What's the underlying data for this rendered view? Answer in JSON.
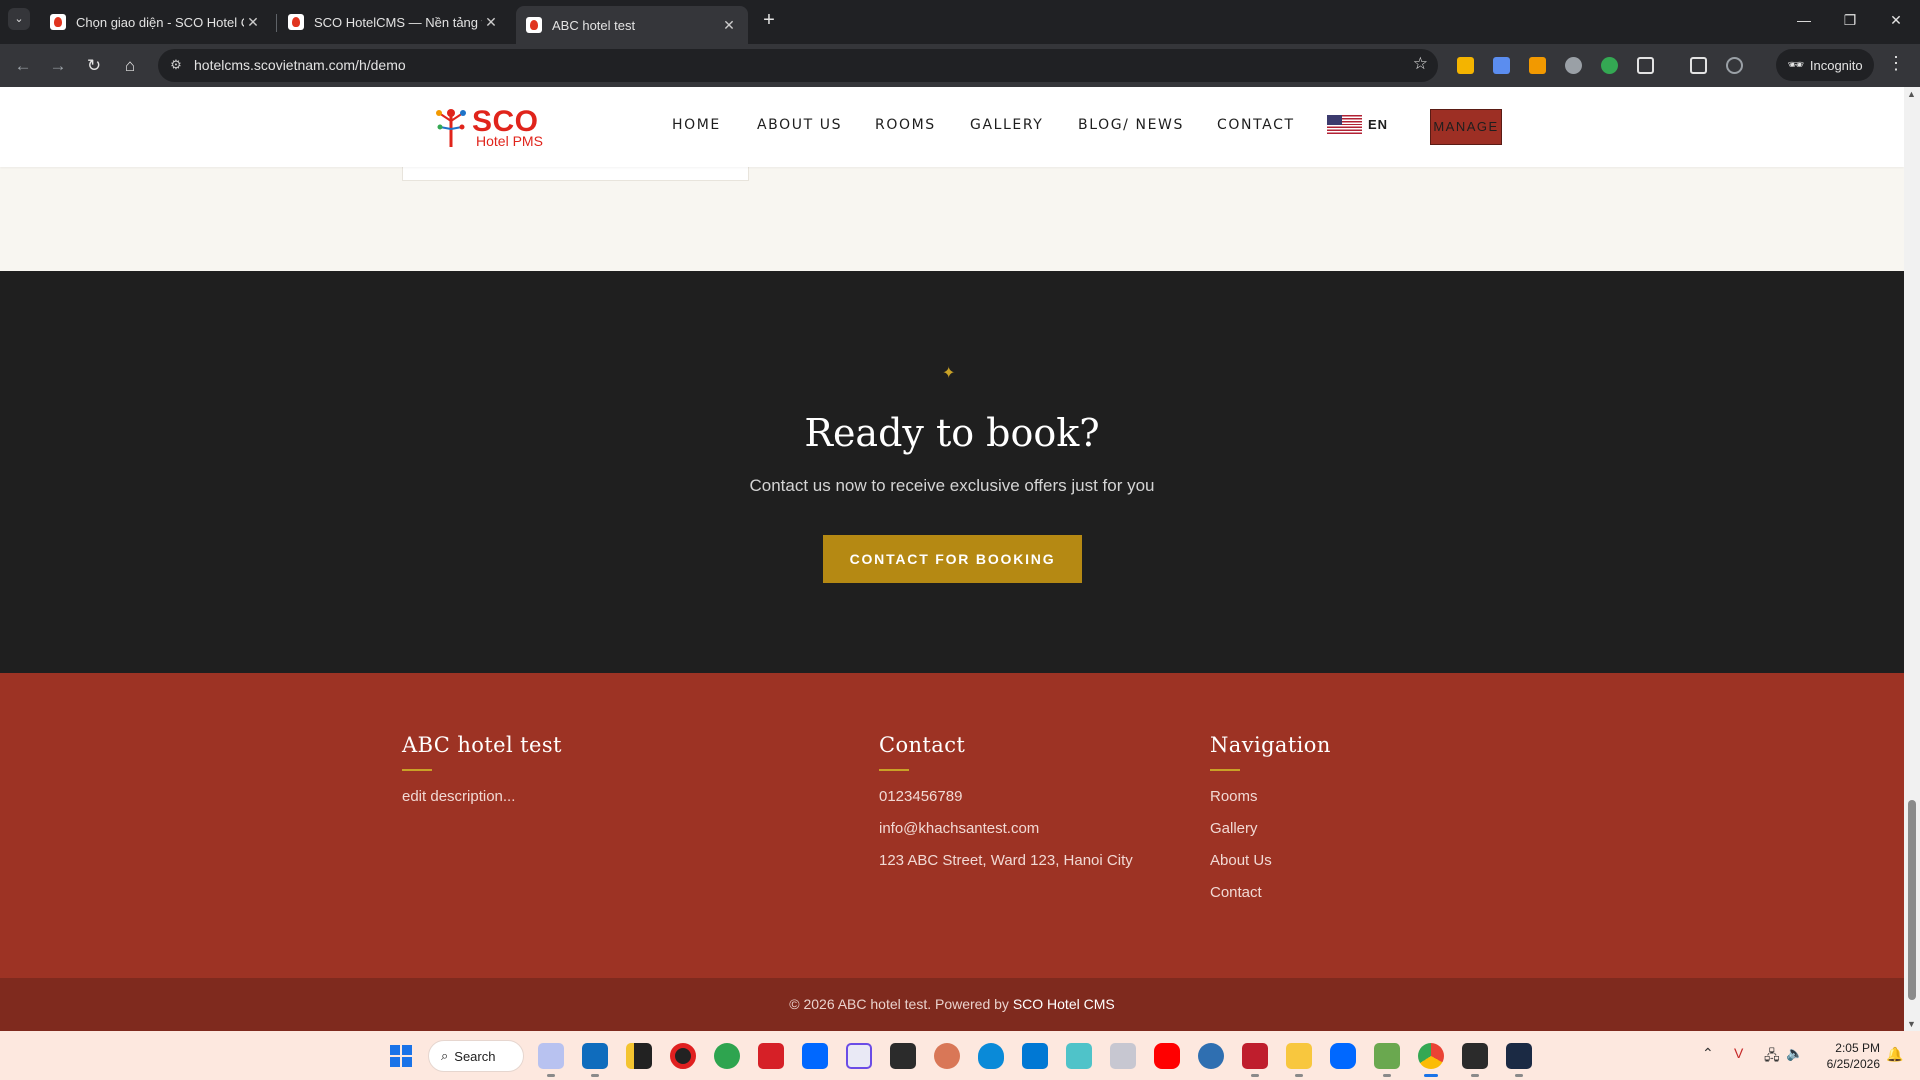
{
  "browser": {
    "tabs": [
      {
        "title": "Chọn giao diện - SCO Hotel CMS",
        "active": false
      },
      {
        "title": "SCO HotelCMS — Nền tảng website",
        "active": false
      },
      {
        "title": "ABC hotel test",
        "active": true
      }
    ],
    "url": "hotelcms.scovietnam.com/h/demo",
    "incognito_label": "Incognito"
  },
  "site": {
    "logo": {
      "brand": "SCO",
      "sub": "Hotel PMS"
    },
    "nav": [
      "HOME",
      "ABOUT US",
      "ROOMS",
      "GALLERY",
      "BLOG/ NEWS",
      "CONTACT"
    ],
    "language": "EN",
    "manage_label": "MANAGE"
  },
  "cta": {
    "title": "Ready to book?",
    "subtitle": "Contact us now to receive exclusive offers just for you",
    "button": "CONTACT FOR BOOKING"
  },
  "footer": {
    "about": {
      "heading": "ABC hotel test",
      "description": "edit description..."
    },
    "contact": {
      "heading": "Contact",
      "phone": "0123456789",
      "email": "info@khachsantest.com",
      "address": "123 ABC Street, Ward 123, Hanoi City"
    },
    "navigation": {
      "heading": "Navigation",
      "links": [
        "Rooms",
        "Gallery",
        "About Us",
        "Contact"
      ]
    },
    "copyright_prefix": "© 2026 ABC hotel test. Powered by",
    "copyright_brand": "SCO Hotel CMS"
  },
  "taskbar": {
    "search_label": "Search",
    "time": "2:05 PM",
    "date": "6/25/2026"
  },
  "colors": {
    "accent_gold": "#b58913",
    "footer_red": "#9d3324",
    "cta_dark": "#1f1f1f",
    "brand_red": "#e0241b"
  }
}
